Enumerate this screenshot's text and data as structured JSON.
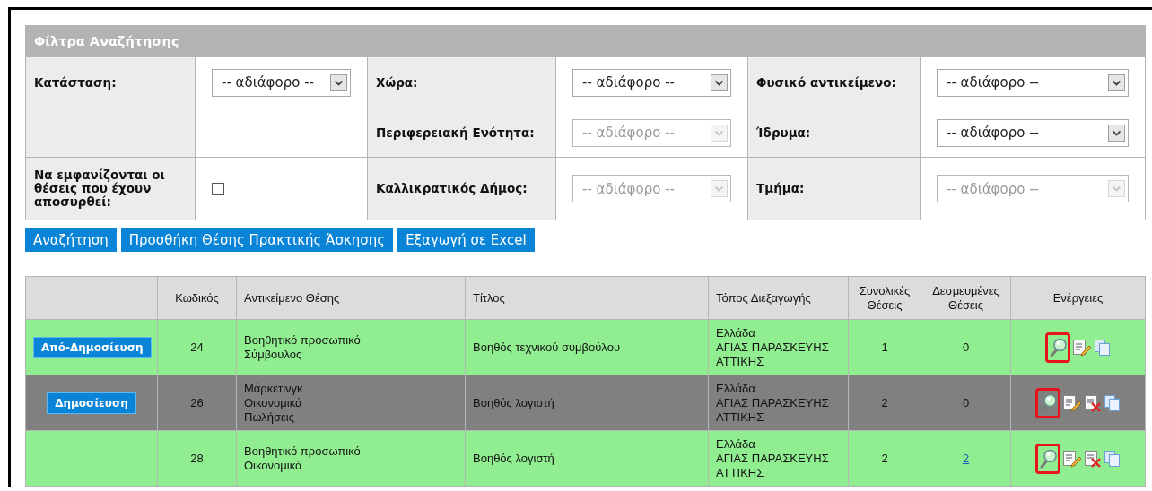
{
  "filter_panel": {
    "title": "Φίλτρα Αναζήτησης",
    "filters": [
      {
        "kind": "select",
        "label": "Κατάσταση:",
        "value": "-- αδιάφορο --",
        "disabled": false
      },
      {
        "kind": "select",
        "label": "Χώρα:",
        "value": "-- αδιάφορο --",
        "disabled": false
      },
      {
        "kind": "select",
        "label": "Φυσικό αντικείμενο:",
        "value": "-- αδιάφορο --",
        "disabled": false
      },
      {
        "kind": "empty"
      },
      {
        "kind": "select",
        "label": "Περιφερειακή Ενότητα:",
        "value": "-- αδιάφορο --",
        "disabled": true
      },
      {
        "kind": "select",
        "label": "Ίδρυμα:",
        "value": "-- αδιάφορο --",
        "disabled": false
      },
      {
        "kind": "checkbox",
        "label": "Να εμφανίζονται οι θέσεις που έχουν αποσυρθεί:",
        "checked": false
      },
      {
        "kind": "select",
        "label": "Καλλικρατικός Δήμος:",
        "value": "-- αδιάφορο --",
        "disabled": true
      },
      {
        "kind": "select",
        "label": "Τμήμα:",
        "value": "-- αδιάφορο --",
        "disabled": true
      }
    ]
  },
  "buttons": [
    "Αναζήτηση",
    "Προσθήκη Θέσης Πρακτικής Άσκησης",
    "Εξαγωγή σε Excel"
  ],
  "table": {
    "columns": [
      "",
      "Κωδικός",
      "Αντικείμενο Θέσης",
      "Τίτλος",
      "Τόπος Διεξαγωγής",
      "Συνολικές Θέσεις",
      "Δεσμευμένες Θέσεις",
      "Ενέργειες"
    ],
    "rows": [
      {
        "published": true,
        "publish_button": "Από-Δημοσίευση",
        "code": "24",
        "subjects": [
          "Βοηθητικό προσωπικό",
          "Σύμβουλος"
        ],
        "title": "Βοηθός τεχνικού συμβούλου",
        "location": [
          "Ελλάδα",
          "ΑΓΙΑΣ ΠΑΡΑΣΚΕΥΗΣ",
          "ΑΤΤΙΚΗΣ"
        ],
        "total": "1",
        "reserved": "0",
        "reserved_link": false,
        "actions": [
          {
            "kind": "view",
            "highlighted": true
          },
          {
            "kind": "edit",
            "highlighted": false
          },
          {
            "kind": "copy",
            "highlighted": false
          }
        ]
      },
      {
        "published": false,
        "publish_button": "Δημοσίευση",
        "code": "26",
        "subjects": [
          "Μάρκετινγκ",
          "Οικονομικά",
          "Πωλήσεις"
        ],
        "title": "Βοηθός λογιστή",
        "location": [
          "Ελλάδα",
          "ΑΓΙΑΣ ΠΑΡΑΣΚΕΥΗΣ",
          "ΑΤΤΙΚΗΣ"
        ],
        "total": "2",
        "reserved": "0",
        "reserved_link": false,
        "actions": [
          {
            "kind": "view",
            "highlighted": true
          },
          {
            "kind": "edit",
            "highlighted": false
          },
          {
            "kind": "delete",
            "highlighted": false
          },
          {
            "kind": "copy",
            "highlighted": false
          }
        ]
      },
      {
        "published": true,
        "code": "28",
        "subjects": [
          "Βοηθητικό προσωπικό",
          "Οικονομικά"
        ],
        "title": "Βοηθός λογιστή",
        "location": [
          "Ελλάδα",
          "ΑΓΙΑΣ ΠΑΡΑΣΚΕΥΗΣ",
          "ΑΤΤΙΚΗΣ"
        ],
        "total": "2",
        "reserved": "2",
        "reserved_link": true,
        "actions": [
          {
            "kind": "view",
            "highlighted": true
          },
          {
            "kind": "edit",
            "highlighted": false
          },
          {
            "kind": "delete",
            "highlighted": false
          },
          {
            "kind": "copy",
            "highlighted": false
          }
        ]
      }
    ]
  }
}
